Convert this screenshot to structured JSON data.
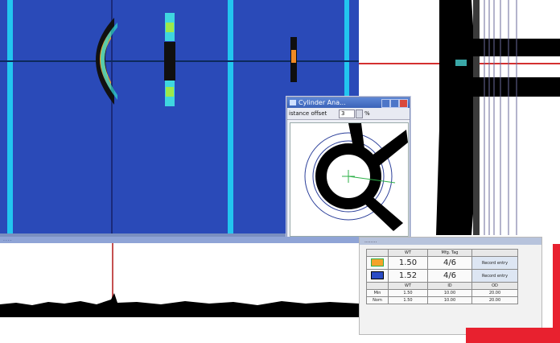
{
  "colors": {
    "scan_background": "#2a4ab8",
    "cyan_line": "#22c6ef",
    "crosshair_red": "#d43030",
    "accent_red": "#e8212f",
    "measure_green": "#2fb24a"
  },
  "cylinder_window": {
    "title": "Cylinder Ana...",
    "distance_label": "istance offset",
    "distance_value": "3",
    "unit": "%"
  },
  "strip": {
    "header": "...."
  },
  "measurements": {
    "title": "........",
    "headers": [
      "WT",
      "Mfg. Tag"
    ],
    "rows": [
      {
        "icon": "green-arrow-marker-icon",
        "wt": "1.50",
        "value": "4/6",
        "action": "Record entry"
      },
      {
        "icon": "blue-arrow-marker-icon",
        "wt": "1.52",
        "value": "4/6",
        "action": "Record entry"
      }
    ],
    "subheaders": [
      "WT",
      "ID",
      "OD"
    ],
    "extra_rows": [
      [
        "Min",
        "1.50",
        "10.00",
        "20.00"
      ],
      [
        "Nom",
        "1.50",
        "10.00",
        "20.00"
      ]
    ]
  }
}
